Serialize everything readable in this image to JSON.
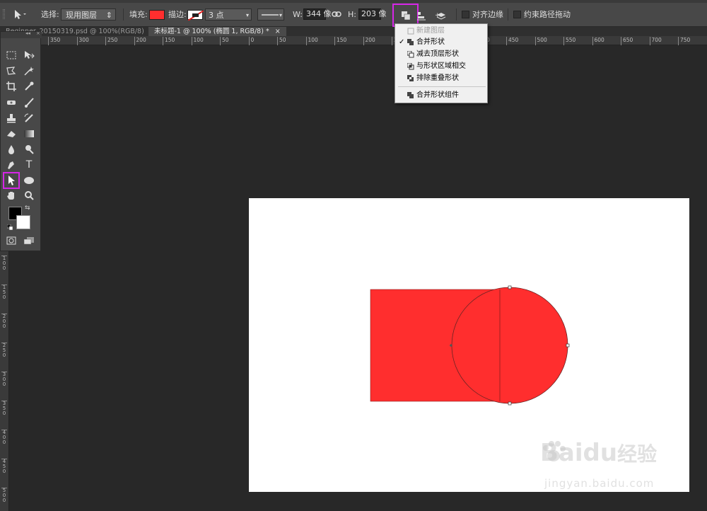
{
  "options_bar": {
    "select_label": "选择:",
    "select_value": "现用图层",
    "fill_label": "填充:",
    "fill_color": "#ff2e2e",
    "stroke_label": "描边:",
    "stroke_size": "3 点",
    "w_label": "W:",
    "w_value": "344 像",
    "h_label": "H:",
    "h_value": "203 像",
    "align_edges_label": "对齐边缘",
    "constrain_label": "约束路径拖动"
  },
  "tabs": [
    {
      "label": "Beginner_20150319.psd @ 100%(RGB/8)",
      "close": "×",
      "active": false
    },
    {
      "label": "未标题-1 @ 100% (椭圆 1, RGB/8) *",
      "close": "×",
      "active": true
    }
  ],
  "hruler": [
    "350",
    "300",
    "250",
    "200",
    "150",
    "100",
    "50",
    "0",
    "50",
    "100",
    "150",
    "200",
    "250",
    "300",
    "350",
    "400",
    "450",
    "500",
    "550",
    "600",
    "650",
    "700",
    "750"
  ],
  "vruler": [
    "1\n0\n0",
    "1\n5\n0",
    "2\n0\n0",
    "2\n5\n0",
    "3\n0\n0",
    "3\n5\n0",
    "4\n0\n0",
    "4\n5\n0",
    "5\n0\n0"
  ],
  "path_ops_menu": {
    "items": [
      {
        "label": "新建图层",
        "disabled": true,
        "checked": false
      },
      {
        "label": "合并形状",
        "disabled": false,
        "checked": true
      },
      {
        "label": "减去顶层形状",
        "disabled": false,
        "checked": false
      },
      {
        "label": "与形状区域相交",
        "disabled": false,
        "checked": false
      },
      {
        "label": "排除重叠形状",
        "disabled": false,
        "checked": false
      },
      {
        "label": "合并形状组件",
        "disabled": false,
        "checked": false
      }
    ],
    "check_mark": "✓"
  },
  "canvas": {
    "shape_color": "#ff2e2e",
    "background": "#ffffff"
  },
  "colors": {
    "foreground": "#000000",
    "background": "#ffffff",
    "highlight": "#d526e6"
  },
  "watermark": {
    "brand": "Bai",
    "brand2": "du",
    "suffix": "经验",
    "url": "jingyan.baidu.com"
  },
  "toolbar_text_tool": "T"
}
